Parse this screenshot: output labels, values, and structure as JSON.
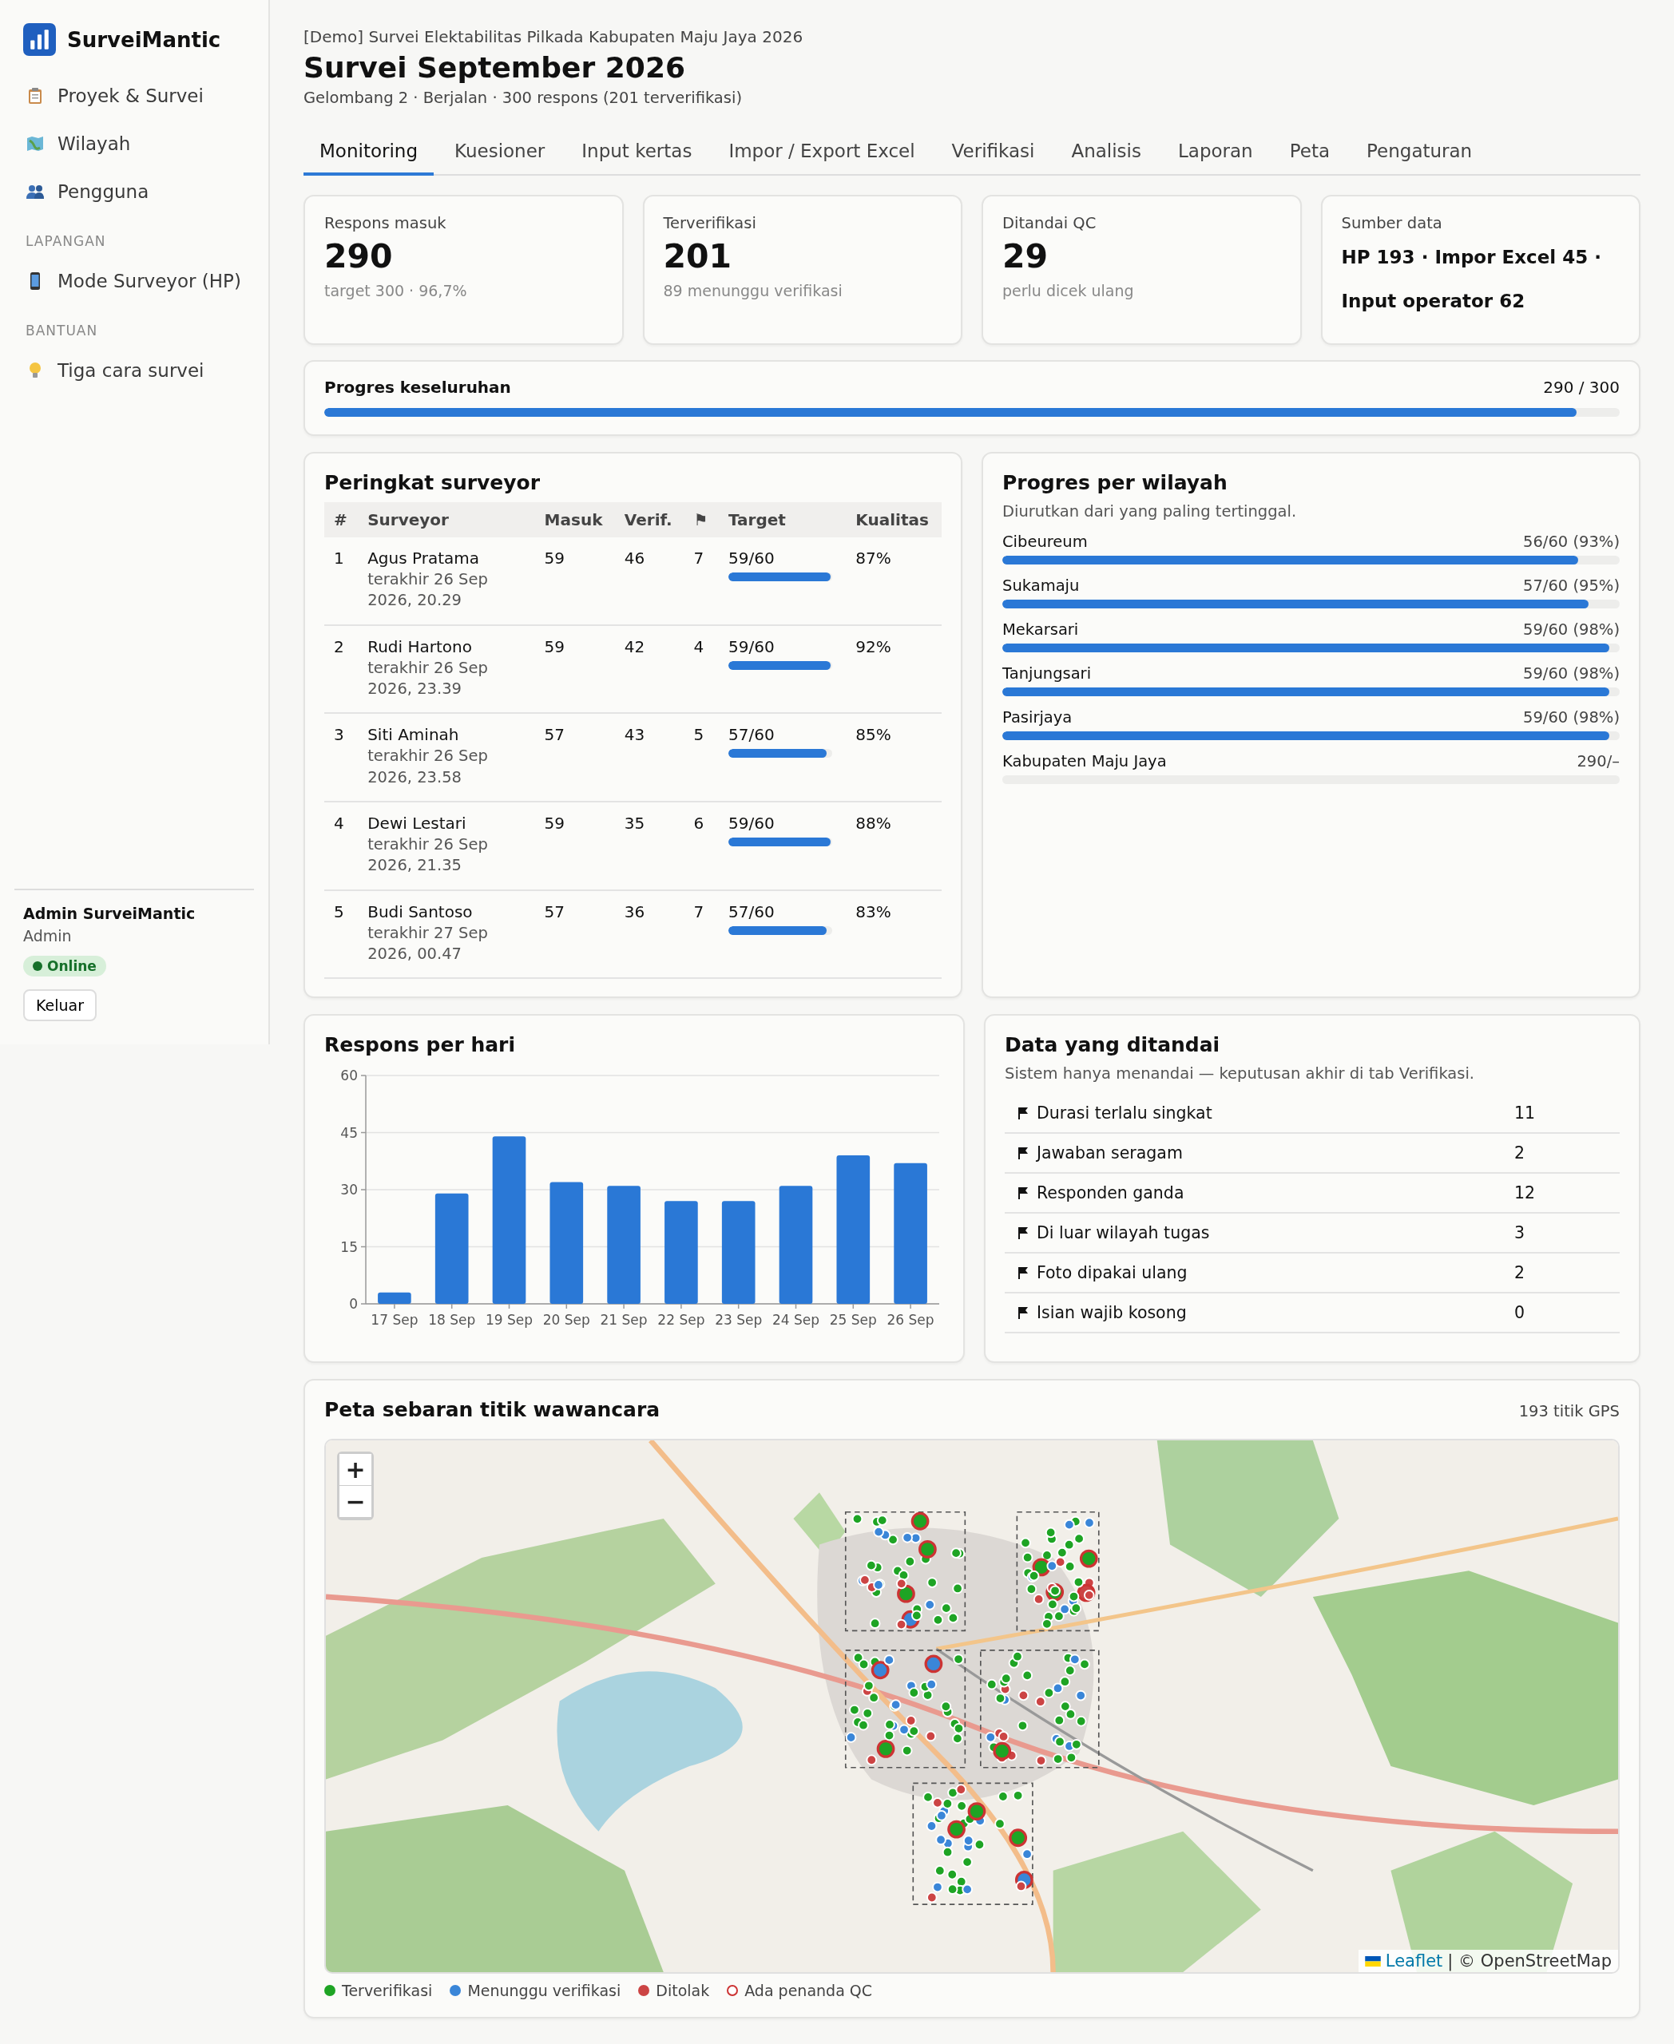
{
  "sidebar": {
    "brand": "SurveiMantic",
    "sections": [
      {
        "items": [
          {
            "kind": "clipboard",
            "label": "Proyek & Survei",
            "selected": false
          },
          {
            "kind": "map",
            "label": "Wilayah",
            "selected": false
          },
          {
            "kind": "people",
            "label": "Pengguna",
            "selected": false
          }
        ]
      },
      {
        "heading": "LAPANGAN",
        "items": [
          {
            "kind": "phone",
            "label": "Mode Surveyor (HP)",
            "selected": false
          }
        ]
      },
      {
        "heading": "BANTUAN",
        "items": [
          {
            "kind": "bulb",
            "label": "Tiga cara survei",
            "selected": false
          }
        ]
      }
    ],
    "user": {
      "name": "Admin SurveiMantic",
      "role": "Admin",
      "status": "Online",
      "online": true
    },
    "logout": "Keluar"
  },
  "header": {
    "breadcrumb": "[Demo] Survei Elektabilitas Pilkada Kabupaten Maju Jaya 2026",
    "title": "Survei September 2026",
    "subtitle": "Gelombang 2 · Berjalan · 300 respons (201 terverifikasi)"
  },
  "tabs": [
    {
      "label": "Monitoring",
      "selected": true
    },
    {
      "label": "Kuesioner",
      "selected": false
    },
    {
      "label": "Input kertas",
      "selected": false
    },
    {
      "label": "Impor / Export Excel",
      "selected": false
    },
    {
      "label": "Verifikasi",
      "selected": false
    },
    {
      "label": "Analisis",
      "selected": false
    },
    {
      "label": "Laporan",
      "selected": false
    },
    {
      "label": "Peta",
      "selected": false
    },
    {
      "label": "Pengaturan",
      "selected": false
    }
  ],
  "stats": [
    {
      "kind": "number",
      "label": "Respons masuk",
      "value": "290",
      "note": "target 300 · 96,7%"
    },
    {
      "kind": "number",
      "label": "Terverifikasi",
      "value": "201",
      "note": "89 menunggu verifikasi"
    },
    {
      "kind": "number",
      "label": "Ditandai QC",
      "value": "29",
      "note": "perlu dicek ulang"
    },
    {
      "kind": "text",
      "label": "Sumber data",
      "value": "HP 193 · Impor Excel 45 · Input operator 62"
    }
  ],
  "overall_progress": {
    "label": "Progres keseluruhan",
    "reading": "290 / 300",
    "level": 0.967
  },
  "surveyor_ranking": {
    "title": "Peringkat surveyor",
    "columns": [
      "#",
      "Surveyor",
      "Masuk",
      "Verif.",
      "⚑",
      "Target",
      "Kualitas"
    ],
    "rows": [
      {
        "rank": "1",
        "name": "Agus Pratama",
        "last_seen": "terakhir 26 Sep 2026, 20.29",
        "masuk": "59",
        "verif": "46",
        "flags": "7",
        "target": "59/60",
        "level": 0.983,
        "quality": "87%"
      },
      {
        "rank": "2",
        "name": "Rudi Hartono",
        "last_seen": "terakhir 26 Sep 2026, 23.39",
        "masuk": "59",
        "verif": "42",
        "flags": "4",
        "target": "59/60",
        "level": 0.983,
        "quality": "92%"
      },
      {
        "rank": "3",
        "name": "Siti Aminah",
        "last_seen": "terakhir 26 Sep 2026, 23.58",
        "masuk": "57",
        "verif": "43",
        "flags": "5",
        "target": "57/60",
        "level": 0.95,
        "quality": "85%"
      },
      {
        "rank": "4",
        "name": "Dewi Lestari",
        "last_seen": "terakhir 26 Sep 2026, 21.35",
        "masuk": "59",
        "verif": "35",
        "flags": "6",
        "target": "59/60",
        "level": 0.983,
        "quality": "88%"
      },
      {
        "rank": "5",
        "name": "Budi Santoso",
        "last_seen": "terakhir 27 Sep 2026, 00.47",
        "masuk": "57",
        "verif": "36",
        "flags": "7",
        "target": "57/60",
        "level": 0.95,
        "quality": "83%"
      }
    ]
  },
  "region_progress": {
    "title": "Progres per wilayah",
    "note": "Diurutkan dari yang paling tertinggal.",
    "regions": [
      {
        "name": "Cibeureum",
        "reading": "56/60 (93%)",
        "level": 0.933
      },
      {
        "name": "Sukamaju",
        "reading": "57/60 (95%)",
        "level": 0.95
      },
      {
        "name": "Mekarsari",
        "reading": "59/60 (98%)",
        "level": 0.983
      },
      {
        "name": "Tanjungsari",
        "reading": "59/60 (98%)",
        "level": 0.983
      },
      {
        "name": "Pasirjaya",
        "reading": "59/60 (98%)",
        "level": 0.983
      },
      {
        "name": "Kabupaten Maju Jaya",
        "reading": "290/–"
      }
    ]
  },
  "daily_responses": {
    "chart_data": {
      "type": "bar",
      "title": "Respons per hari",
      "categories": [
        "17 Sep",
        "18 Sep",
        "19 Sep",
        "20 Sep",
        "21 Sep",
        "22 Sep",
        "23 Sep",
        "24 Sep",
        "25 Sep",
        "26 Sep"
      ],
      "values": [
        3,
        29,
        44,
        32,
        31,
        27,
        27,
        31,
        39,
        37
      ],
      "ylim": [
        0,
        60
      ],
      "yticks": [
        0,
        15,
        30,
        45,
        60
      ],
      "grid": true
    }
  },
  "flagged": {
    "title": "Data yang ditandai",
    "note": "Sistem hanya menandai — keputusan akhir di tab Verifikasi.",
    "items": [
      {
        "label": "Durasi terlalu singkat",
        "count": "11"
      },
      {
        "label": "Jawaban seragam",
        "count": "2"
      },
      {
        "label": "Responden ganda",
        "count": "12"
      },
      {
        "label": "Di luar wilayah tugas",
        "count": "3"
      },
      {
        "label": "Foto dipakai ulang",
        "count": "2"
      },
      {
        "label": "Isian wajib kosong",
        "count": "0"
      }
    ]
  },
  "map": {
    "title": "Peta sebaran titik wawancara",
    "count": "193 titik GPS",
    "zoom_in": "+",
    "zoom_out": "−",
    "attribution_link": "Leaflet",
    "attribution_text": "| © OpenStreetMap",
    "legend": [
      {
        "kind": "dot",
        "label": "Terverifikasi",
        "color": "#1ea424"
      },
      {
        "kind": "dot",
        "label": "Menunggu verifikasi",
        "color": "#3a86d8"
      },
      {
        "kind": "dot",
        "label": "Ditolak",
        "color": "#cc4444"
      },
      {
        "kind": "ring",
        "label": "Ada penanda QC",
        "color": "#cc3333"
      }
    ]
  }
}
